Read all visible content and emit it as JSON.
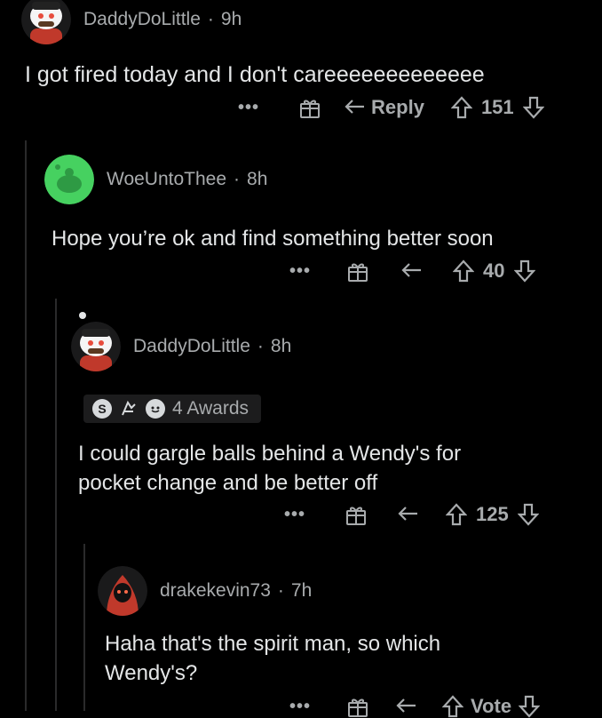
{
  "comments": [
    {
      "user": "DaddyDoLittle",
      "time": "9h",
      "text": "I got fired today and I don't careeeeeeeeeeeee",
      "reply_label": "Reply",
      "score": "151"
    },
    {
      "user": "WoeUntoThee",
      "time": "8h",
      "text": "Hope you’re ok and find something better soon",
      "score": "40"
    },
    {
      "user": "DaddyDoLittle",
      "time": "8h",
      "awards_label": "4 Awards",
      "text_lines": [
        "I could gargle balls behind a Wendy's for",
        "pocket change and be better off"
      ],
      "score": "125"
    },
    {
      "user": "drakekevin73",
      "time": "7h",
      "text_lines": [
        "Haha that's the spirit man, so which",
        "Wendy's?"
      ],
      "score": "Vote"
    }
  ],
  "separator": "·",
  "more_glyph": "•••",
  "colors": {
    "background": "#000000",
    "text": "#e4e6e7",
    "meta": "#a8abad",
    "snoo_green": "#46d160",
    "snoo_red": "#ff4500"
  }
}
